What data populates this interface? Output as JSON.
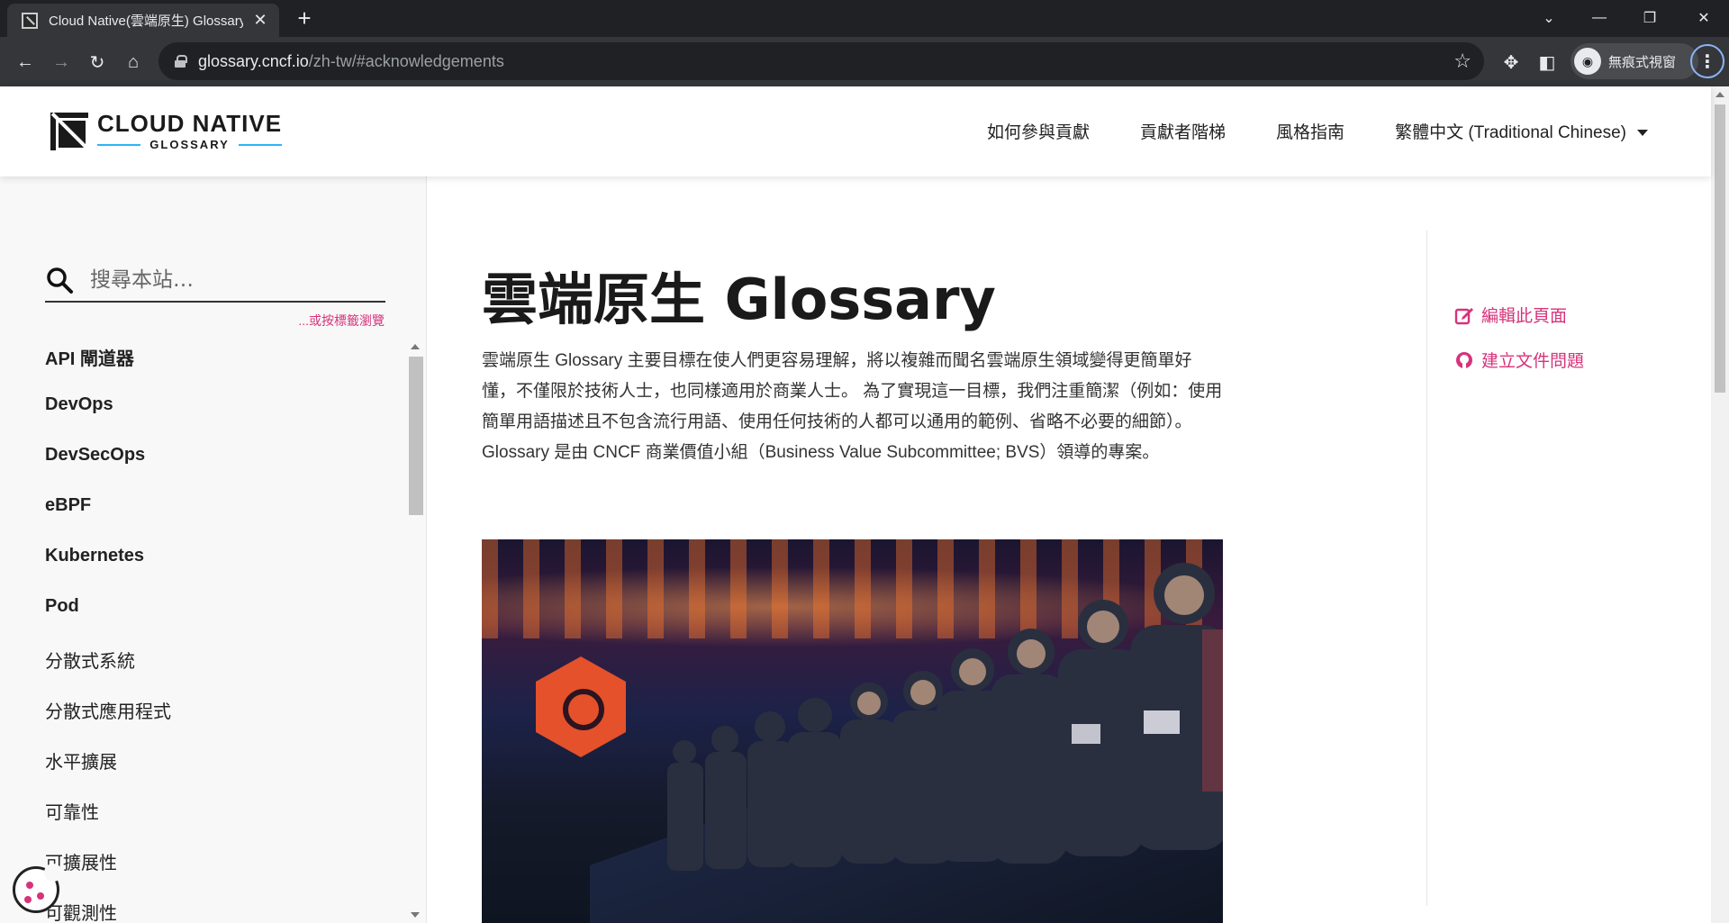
{
  "browser": {
    "tab_title": "Cloud Native(雲端原生) Glossary",
    "new_tab_symbol": "+",
    "url_host": "glossary.cncf.io",
    "url_path": "/zh-tw/#acknowledgements",
    "incognito_label": "無痕式視窗",
    "icons": [
      "back-arrow-icon",
      "forward-arrow-icon",
      "reload-icon",
      "home-icon",
      "lock-icon",
      "star-icon",
      "extensions-icon",
      "side-panel-icon",
      "incognito-icon",
      "menu-icon"
    ]
  },
  "header": {
    "logo_line1": "CLOUD NATIVE",
    "logo_line2": "GLOSSARY",
    "nav": [
      {
        "label": "如何參與貢獻"
      },
      {
        "label": "貢獻者階梯"
      },
      {
        "label": "風格指南"
      },
      {
        "label": "繁體中文 (Traditional Chinese)"
      }
    ]
  },
  "sidebar": {
    "search_placeholder": "搜尋本站…",
    "tag_browse": "...或按標籤瀏覽",
    "items": [
      {
        "label": "API 閘道器",
        "bold": true
      },
      {
        "label": "DevOps",
        "bold": true
      },
      {
        "label": "DevSecOps",
        "bold": true
      },
      {
        "label": "eBPF",
        "bold": true
      },
      {
        "label": "Kubernetes",
        "bold": true
      },
      {
        "label": "Pod",
        "bold": true
      },
      {
        "label": "分散式系統",
        "bold": false
      },
      {
        "label": "分散式應用程式",
        "bold": false
      },
      {
        "label": "水平擴展",
        "bold": false
      },
      {
        "label": "可靠性",
        "bold": false
      },
      {
        "label": "可擴展性",
        "bold": false
      },
      {
        "label": "可觀測性",
        "bold": false
      }
    ]
  },
  "main": {
    "title": "雲端原生 Glossary",
    "intro": "雲端原生 Glossary 主要目標在使人們更容易理解，將以複雜而聞名雲端原生領域變得更簡單好懂，不僅限於技術人士，也同樣適用於商業人士。 為了實現這一目標，我們注重簡潔（例如：使用簡單用語描述且不包含流行用語、使用任何技術的人都可以通用的範例、省略不必要的細節）。 Glossary 是由 CNCF 商業價值小組（Business Value Subcommittee; BVS）領導的專案。"
  },
  "toc": {
    "edit_page": "編輯此頁面",
    "create_issue": "建立文件問題"
  },
  "colors": {
    "accent": "#d6337b",
    "logo_line": "#29b6f6",
    "chrome_dark": "#202124",
    "chrome_toolbar": "#35363a"
  }
}
